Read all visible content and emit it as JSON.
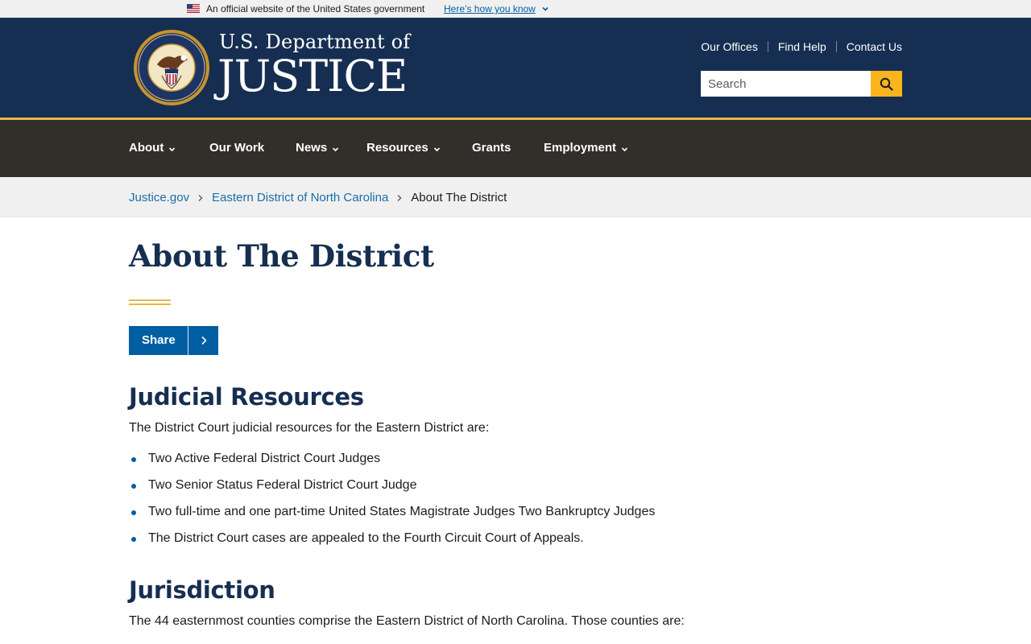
{
  "gov_banner": {
    "official_text": "An official website of the United States government",
    "how_link": "Here’s how you know"
  },
  "header": {
    "brand_line1": "U.S. Department of",
    "brand_line2": "JUSTICE",
    "utility_links": [
      "Our Offices",
      "Find Help",
      "Contact Us"
    ],
    "search": {
      "placeholder": "Search"
    }
  },
  "nav": {
    "items": [
      {
        "label": "About",
        "has_dropdown": true
      },
      {
        "label": "Our Work",
        "has_dropdown": false
      },
      {
        "label": "News",
        "has_dropdown": true
      },
      {
        "label": "Resources",
        "has_dropdown": true
      },
      {
        "label": "Grants",
        "has_dropdown": false
      },
      {
        "label": "Employment",
        "has_dropdown": true
      }
    ]
  },
  "breadcrumb": {
    "items": [
      "Justice.gov",
      "Eastern District of North Carolina"
    ],
    "current": "About The District"
  },
  "main": {
    "title": "About The District",
    "share_label": "Share",
    "sections": [
      {
        "heading": "Judicial Resources",
        "intro": "The District Court judicial resources for the Eastern District are:",
        "bullets": [
          "Two Active Federal District Court Judges",
          "Two Senior Status Federal District Court Judge",
          "Two full-time and one part-time United States Magistrate Judges Two Bankruptcy Judges",
          "The District Court cases are appealed to the Fourth Circuit Court of Appeals."
        ]
      },
      {
        "heading": "Jurisdiction",
        "intro": "The 44 easternmost counties comprise the Eastern District of North Carolina. Those counties are:"
      }
    ]
  },
  "colors": {
    "header_navy": "#162e51",
    "nav_dark": "#302f2a",
    "gold_accent": "#e5b849",
    "search_button": "#fab51d",
    "link_blue": "#005ea2"
  },
  "icons": {
    "flag": "us-flag-icon",
    "seal": "doj-seal-icon",
    "search": "search-icon",
    "dropdown": "chevron-down-icon",
    "breadcrumb_sep": "chevron-right-icon",
    "share_arrow": "chevron-right-icon"
  }
}
